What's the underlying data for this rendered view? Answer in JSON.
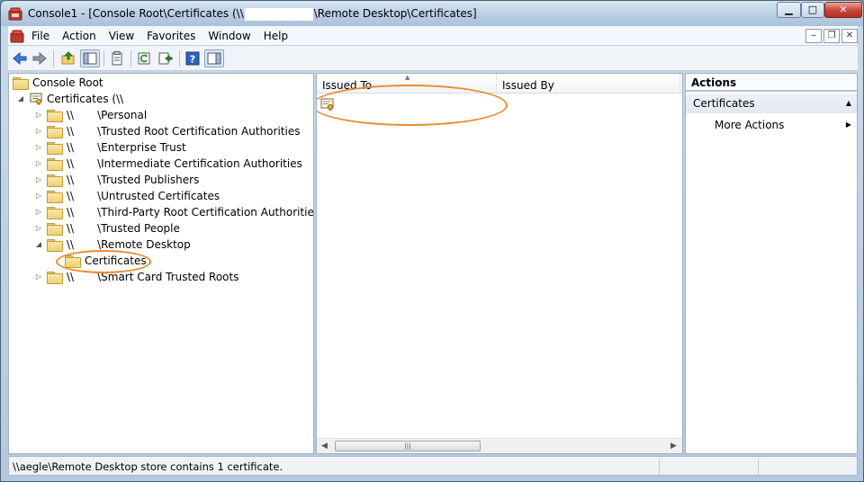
{
  "window": {
    "title_prefix": "Console1 - [Console Root\\Certificates (\\\\",
    "title_suffix": "\\Remote Desktop\\Certificates]",
    "min_glyph": "▁",
    "max_glyph": "□",
    "close_glyph": "✕"
  },
  "menubar": {
    "items": [
      "File",
      "Action",
      "View",
      "Favorites",
      "Window",
      "Help"
    ],
    "mdi_min": "‒",
    "mdi_restore": "❐",
    "mdi_close": "✕"
  },
  "toolbar": {
    "icons": [
      "back-icon",
      "forward-icon",
      "up-folder-icon",
      "show-hide-tree-icon",
      "export-list-icon",
      "refresh-icon",
      "export-icon",
      "help-icon",
      "show-action-pane-icon"
    ]
  },
  "tree": {
    "items": [
      {
        "label": "Console Root",
        "toggle": ""
      },
      {
        "label": "Certificates (\\\\",
        "toggle": "◢"
      },
      {
        "prefix": "\\\\",
        "label": "\\Personal",
        "toggle": "▷"
      },
      {
        "prefix": "\\\\",
        "label": "\\Trusted Root Certification Authorities",
        "toggle": "▷"
      },
      {
        "prefix": "\\\\",
        "label": "\\Enterprise Trust",
        "toggle": "▷"
      },
      {
        "prefix": "\\\\",
        "label": "\\Intermediate Certification Authorities",
        "toggle": "▷"
      },
      {
        "prefix": "\\\\",
        "label": "\\Trusted Publishers",
        "toggle": "▷"
      },
      {
        "prefix": "\\\\",
        "label": "\\Untrusted Certificates",
        "toggle": "▷"
      },
      {
        "prefix": "\\\\",
        "label": "\\Third-Party Root Certification Authorities",
        "toggle": "▷"
      },
      {
        "prefix": "\\\\",
        "label": "\\Trusted People",
        "toggle": "▷"
      },
      {
        "prefix": "\\\\",
        "label": "\\Remote Desktop",
        "toggle": "◢"
      },
      {
        "label": "Certificates",
        "toggle": ""
      },
      {
        "prefix": "\\\\",
        "label": "\\Smart Card Trusted Roots",
        "toggle": "▷"
      }
    ]
  },
  "list": {
    "columns": [
      "Issued To",
      "Issued By"
    ],
    "sort_glyph": "▲",
    "scroll_left": "◀",
    "scroll_right": "▶",
    "thumb_grip": "|||"
  },
  "actions": {
    "title": "Actions",
    "section": "Certificates",
    "section_caret": "▲",
    "item": "More Actions",
    "item_caret": "▶"
  },
  "status": {
    "text": "\\\\aegle\\Remote Desktop store contains 1 certificate."
  },
  "colors": {
    "callout": "#ec8a2c",
    "folder": "#f1cf72"
  }
}
